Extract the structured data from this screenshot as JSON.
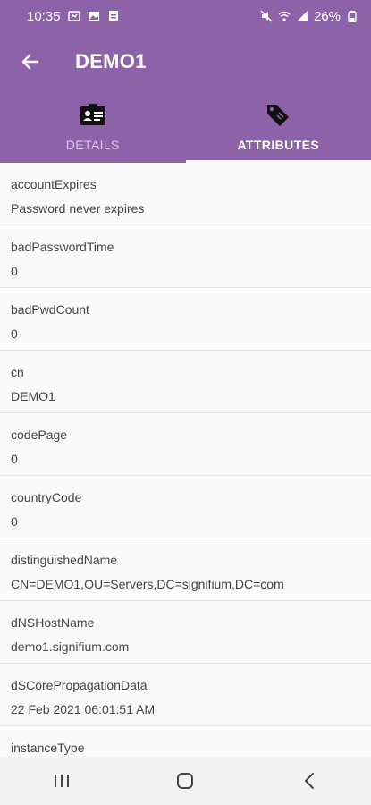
{
  "status_bar": {
    "time": "10:35",
    "battery": "26%"
  },
  "toolbar": {
    "title": "DEMO1",
    "back_icon": "arrow-back-icon"
  },
  "tabs": [
    {
      "label": "DETAILS",
      "icon": "id-card-icon",
      "active": false
    },
    {
      "label": "ATTRIBUTES",
      "icon": "tag-icon",
      "active": true
    }
  ],
  "attributes": [
    {
      "name": "accountExpires",
      "value": "Password never expires"
    },
    {
      "name": "badPasswordTime",
      "value": "0"
    },
    {
      "name": "badPwdCount",
      "value": "0"
    },
    {
      "name": "cn",
      "value": "DEMO1"
    },
    {
      "name": "codePage",
      "value": "0"
    },
    {
      "name": "countryCode",
      "value": "0"
    },
    {
      "name": "distinguishedName",
      "value": "CN=DEMO1,OU=Servers,DC=signifium,DC=com"
    },
    {
      "name": "dNSHostName",
      "value": "demo1.signifium.com"
    },
    {
      "name": "dSCorePropagationData",
      "value": "22 Feb 2021 06:01:51 AM"
    },
    {
      "name": "instanceType",
      "value": ""
    }
  ],
  "colors": {
    "primary": "#8c62a8",
    "list_background": "#fafafa",
    "text": "#444444"
  }
}
